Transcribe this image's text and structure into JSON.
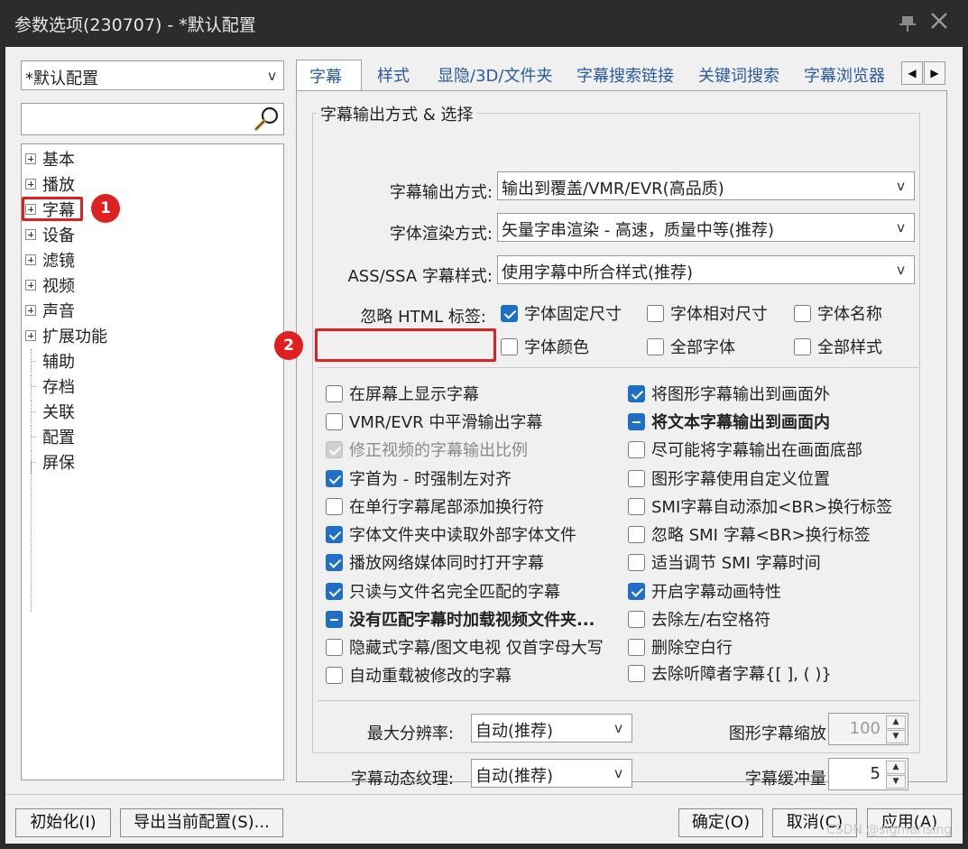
{
  "window": {
    "title": "参数选项(230707) - *默认配置"
  },
  "sidebar": {
    "profile": "*默认配置",
    "search_placeholder": "",
    "tree": [
      {
        "label": "基本",
        "expandable": true
      },
      {
        "label": "播放",
        "expandable": true
      },
      {
        "label": "字幕",
        "expandable": true
      },
      {
        "label": "设备",
        "expandable": true
      },
      {
        "label": "滤镜",
        "expandable": true
      },
      {
        "label": "视频",
        "expandable": true
      },
      {
        "label": "声音",
        "expandable": true
      },
      {
        "label": "扩展功能",
        "expandable": true
      },
      {
        "label": "辅助",
        "expandable": false
      },
      {
        "label": "存档",
        "expandable": false
      },
      {
        "label": "关联",
        "expandable": false
      },
      {
        "label": "配置",
        "expandable": false
      },
      {
        "label": "屏保",
        "expandable": false
      }
    ]
  },
  "annotations": {
    "badge1": "1",
    "badge2": "2"
  },
  "tabs": [
    "字幕",
    "样式",
    "显隐/3D/文件夹",
    "字幕搜索链接",
    "关键词搜索",
    "字幕浏览器"
  ],
  "tab_scroll": {
    "left": "◀",
    "right": "▶"
  },
  "group": {
    "title": "字幕输出方式 & 选择",
    "output_mode_label": "字幕输出方式:",
    "output_mode_value": "输出到覆盖/VMR/EVR(高品质)",
    "render_mode_label": "字体渲染方式:",
    "render_mode_value": "矢量字串渲染 - 高速，质量中等(推荐)",
    "ass_style_label": "ASS/SSA 字幕样式:",
    "ass_style_value": "使用字幕中所合样式(推荐)",
    "ignore_html_label": "忽略 HTML 标签:",
    "html_options": [
      {
        "label": "字体固定尺寸",
        "state": "checked"
      },
      {
        "label": "字体相对尺寸",
        "state": "unchecked"
      },
      {
        "label": "字体名称",
        "state": "unchecked"
      },
      {
        "label": "字体颜色",
        "state": "unchecked"
      },
      {
        "label": "全部字体",
        "state": "unchecked"
      },
      {
        "label": "全部样式",
        "state": "unchecked"
      }
    ],
    "left_options": [
      {
        "label": "在屏幕上显示字幕",
        "state": "unchecked"
      },
      {
        "label": "VMR/EVR 中平滑输出字幕",
        "state": "unchecked"
      },
      {
        "label": "修正视频的字幕输出比例",
        "state": "disabled"
      },
      {
        "label": "字首为 - 时强制左对齐",
        "state": "checked"
      },
      {
        "label": "在单行字幕尾部添加换行符",
        "state": "unchecked"
      },
      {
        "label": "字体文件夹中读取外部字体文件",
        "state": "checked"
      },
      {
        "label": "播放网络媒体同时打开字幕",
        "state": "checked"
      },
      {
        "label": "只读与文件名完全匹配的字幕",
        "state": "checked"
      },
      {
        "label": "没有匹配字幕时加载视频文件夹...",
        "state": "indeterminate"
      },
      {
        "label": "隐藏式字幕/图文电视 仅首字母大写",
        "state": "unchecked"
      },
      {
        "label": "自动重载被修改的字幕",
        "state": "unchecked"
      }
    ],
    "right_options": [
      {
        "label": "将图形字幕输出到画面外",
        "state": "checked"
      },
      {
        "label": "将文本字幕输出到画面内",
        "state": "indeterminate"
      },
      {
        "label": "尽可能将字幕输出在画面底部",
        "state": "unchecked"
      },
      {
        "label": "图形字幕使用自定义位置",
        "state": "unchecked"
      },
      {
        "label": "SMI字幕自动添加<BR>换行标签",
        "state": "unchecked"
      },
      {
        "label": "忽略 SMI 字幕<BR>换行标签",
        "state": "unchecked"
      },
      {
        "label": "适当调节 SMI 字幕时间",
        "state": "unchecked"
      },
      {
        "label": "开启字幕动画特性",
        "state": "checked"
      },
      {
        "label": "去除左/右空格符",
        "state": "unchecked"
      },
      {
        "label": "删除空白行",
        "state": "unchecked"
      },
      {
        "label": "去除听障者字幕{[ ], ( )}",
        "state": "unchecked"
      }
    ],
    "max_res_label": "最大分辨率:",
    "max_res_value": "自动(推荐)",
    "texture_label": "字幕动态纹理:",
    "texture_value": "自动(推荐)",
    "bitmap_zoom_label": "图形字幕缩放:",
    "bitmap_zoom_value": "100",
    "buffer_label": "字幕缓冲量:",
    "buffer_value": "5"
  },
  "buttons": {
    "reset": "初始化(I)",
    "export": "导出当前配置(S)...",
    "ok": "确定(O)",
    "cancel": "取消(C)",
    "apply": "应用(A)"
  },
  "watermark": "CSDN @sigmarising",
  "colors": {
    "accent": "#1f6fc6",
    "annotation": "#e02020",
    "tab_text": "#2a5aa0"
  }
}
